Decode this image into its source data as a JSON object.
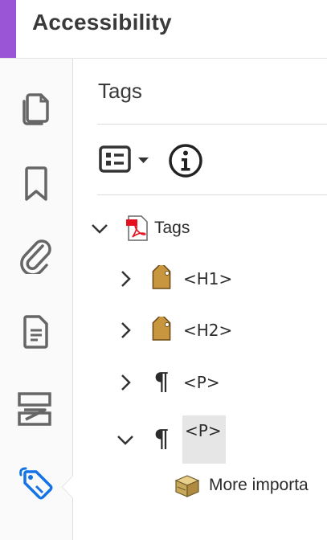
{
  "header": {
    "title": "Accessibility",
    "accent_color": "#9a55d6"
  },
  "sidebar": {
    "items": [
      {
        "name": "page-thumbnails",
        "icon": "pages-icon"
      },
      {
        "name": "bookmarks",
        "icon": "bookmark-icon"
      },
      {
        "name": "attachments",
        "icon": "paperclip-icon"
      },
      {
        "name": "content",
        "icon": "document-icon"
      },
      {
        "name": "order",
        "icon": "reading-order-icon"
      },
      {
        "name": "tags",
        "icon": "tag-icon",
        "active": true
      }
    ],
    "active_color": "#1473e6"
  },
  "panel": {
    "title": "Tags",
    "toolbar": {
      "options_icon": "options-list-icon",
      "info_icon": "info-icon"
    }
  },
  "tree": {
    "root": {
      "label": "Tags",
      "expanded": true,
      "icon": "pdf-icon"
    },
    "children": [
      {
        "label": "<H1>",
        "icon": "tag-label-icon",
        "expanded": false
      },
      {
        "label": "<H2>",
        "icon": "tag-label-icon",
        "expanded": false
      },
      {
        "label": "<P>",
        "icon": "pilcrow-icon",
        "expanded": false
      },
      {
        "label": "<P>",
        "icon": "pilcrow-icon",
        "expanded": true,
        "selected": true
      }
    ],
    "grandchild": {
      "label": "More importa",
      "icon": "content-box-icon"
    }
  }
}
